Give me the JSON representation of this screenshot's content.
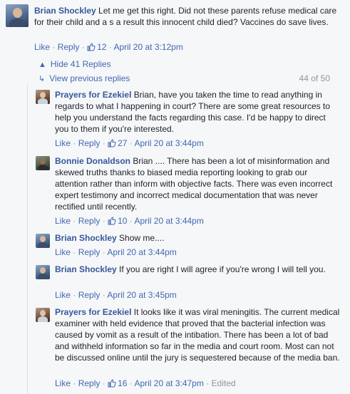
{
  "comments": [
    {
      "author": "Brian Shockley",
      "text": "Let me get this right. Did not these parents refuse medical care for their child and a s a result this innocent child died? Vaccines do save lives.",
      "like": "Like",
      "reply": "Reply",
      "likes": "12",
      "time": "April 20 at 3:12pm"
    }
  ],
  "thread": {
    "hide_label": "Hide 41 Replies",
    "view_previous": "View previous replies",
    "counter": "44 of 50"
  },
  "replies": [
    {
      "author": "Prayers for Ezekiel",
      "text": "Brian, have you taken the time to read anything in regards to what I happening in court? There are some great resources to help you understand the facts regarding this case. I'd be happy to direct you to them if you're interested.",
      "like": "Like",
      "reply": "Reply",
      "likes": "27",
      "time": "April 20 at 3:44pm"
    },
    {
      "author": "Bonnie Donaldson",
      "text": "Brian .... There has been a lot of misinformation and skewed truths thanks to biased media reporting looking to grab our attention rather than inform with objective facts. There was even incorrect expert testimony and incorrect medical documentation that was never rectified until recently.",
      "like": "Like",
      "reply": "Reply",
      "likes": "10",
      "time": "April 20 at 3:44pm"
    },
    {
      "author": "Brian Shockley",
      "text": "Show me....",
      "like": "Like",
      "reply": "Reply",
      "likes": "",
      "time": "April 20 at 3:44pm"
    },
    {
      "author": "Brian Shockley",
      "text": "If you are right I will agree if you're wrong I will tell you.",
      "like": "Like",
      "reply": "Reply",
      "likes": "",
      "time": "April 20 at 3:45pm"
    },
    {
      "author": "Prayers for Ezekiel",
      "text": "It looks like it was viral meningitis. The current medical examiner with held evidence that proved that the bacterial infection was caused by vomit as a result of the intibation. There has been a lot of bad and withheld information so far in the media and court room. Most can not be discussed online until the jury is sequestered because of the media ban.",
      "like": "Like",
      "reply": "Reply",
      "likes": "16",
      "time": "April 20 at 3:47pm",
      "edited": "Edited"
    }
  ],
  "colors": {
    "link": "#4267b2",
    "author": "#365899",
    "meta": "#90949c",
    "background": "#f6f7f9"
  },
  "icons": {
    "like": "thumbs-up-icon",
    "collapse": "caret-up-icon",
    "expand": "reply-arrow-icon"
  }
}
